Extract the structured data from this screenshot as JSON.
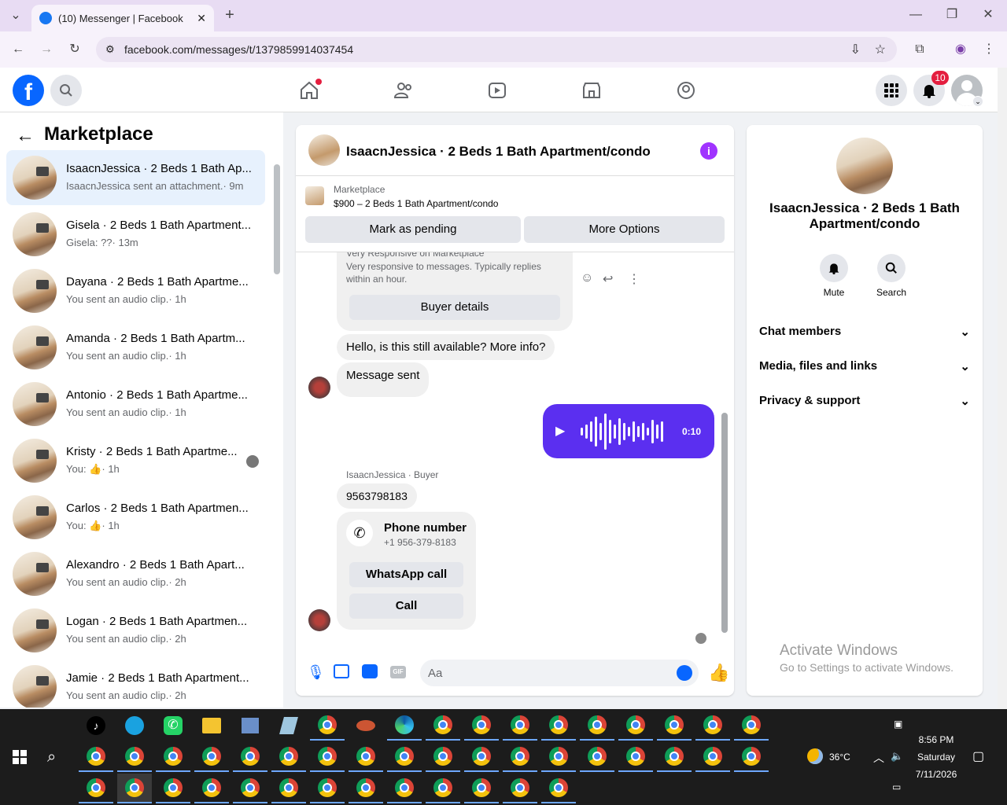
{
  "browser": {
    "tab_title": "(10) Messenger | Facebook",
    "url": "facebook.com/messages/t/1379859914037454"
  },
  "fb": {
    "notif_count": "10"
  },
  "left": {
    "title": "Marketplace",
    "chats": [
      {
        "name": "IsaacnJessica · 2 Beds 1 Bath Ap...",
        "msg": "IsaacnJessica sent an attachment.· 9m"
      },
      {
        "name": "Gisela · 2 Beds 1 Bath Apartment...",
        "msg": "Gisela: ??· 13m"
      },
      {
        "name": "Dayana · 2 Beds 1 Bath Apartme...",
        "msg": "You sent an audio clip.· 1h"
      },
      {
        "name": "Amanda · 2 Beds 1 Bath Apartm...",
        "msg": "You sent an audio clip.· 1h"
      },
      {
        "name": "Antonio · 2 Beds 1 Bath Apartme...",
        "msg": "You sent an audio clip.· 1h"
      },
      {
        "name": "Kristy · 2 Beds 1 Bath Apartme...",
        "msg_prefix": "You:",
        "msg_suffix": "· 1h"
      },
      {
        "name": "Carlos · 2 Beds 1 Bath Apartmen...",
        "msg_prefix": "You:",
        "msg_suffix": "· 1h"
      },
      {
        "name": "Alexandro · 2 Beds 1 Bath Apart...",
        "msg": "You sent an audio clip.· 2h"
      },
      {
        "name": "Logan · 2 Beds 1 Bath Apartmen...",
        "msg": "You sent an audio clip.· 2h"
      },
      {
        "name": "Jamie · 2 Beds 1 Bath Apartment...",
        "msg": "You sent an audio clip.· 2h"
      }
    ]
  },
  "conversation": {
    "title": "IsaacnJessica · 2 Beds 1 Bath Apartment/condo",
    "listing_label": "Marketplace",
    "listing_detail": "$900 – 2 Beds 1 Bath Apartment/condo",
    "mark_pending": "Mark as pending",
    "more_options": "More Options",
    "responsive_title": "Very Responsive on Marketplace",
    "responsive_text": "Very responsive to messages. Typically replies within an hour.",
    "buyer_details": "Buyer details",
    "msg1": "Hello, is this still available? More info?",
    "msg2": "Message sent",
    "audio_time": "0:10",
    "sender_label": "IsaacnJessica · Buyer",
    "msg3": "9563798183",
    "phone_title": "Phone number",
    "phone_value": "+1 956-379-8183",
    "whatsapp": "WhatsApp call",
    "call": "Call",
    "input_placeholder": "Aa"
  },
  "right": {
    "name": "IsaacnJessica · 2 Beds 1 Bath Apartment/condo",
    "mute": "Mute",
    "search": "Search",
    "rows": [
      "Chat members",
      "Media, files and links",
      "Privacy & support"
    ],
    "watermark_title": "Activate Windows",
    "watermark_text": "Go to Settings to activate Windows."
  },
  "taskbar": {
    "temp": "36°C",
    "time": "8:56 PM",
    "day": "Saturday",
    "date": "7/11/2026"
  },
  "colors": {
    "accent": "#0866ff",
    "audio": "#5b2ff0",
    "messenger_purple": "#a033ff"
  }
}
